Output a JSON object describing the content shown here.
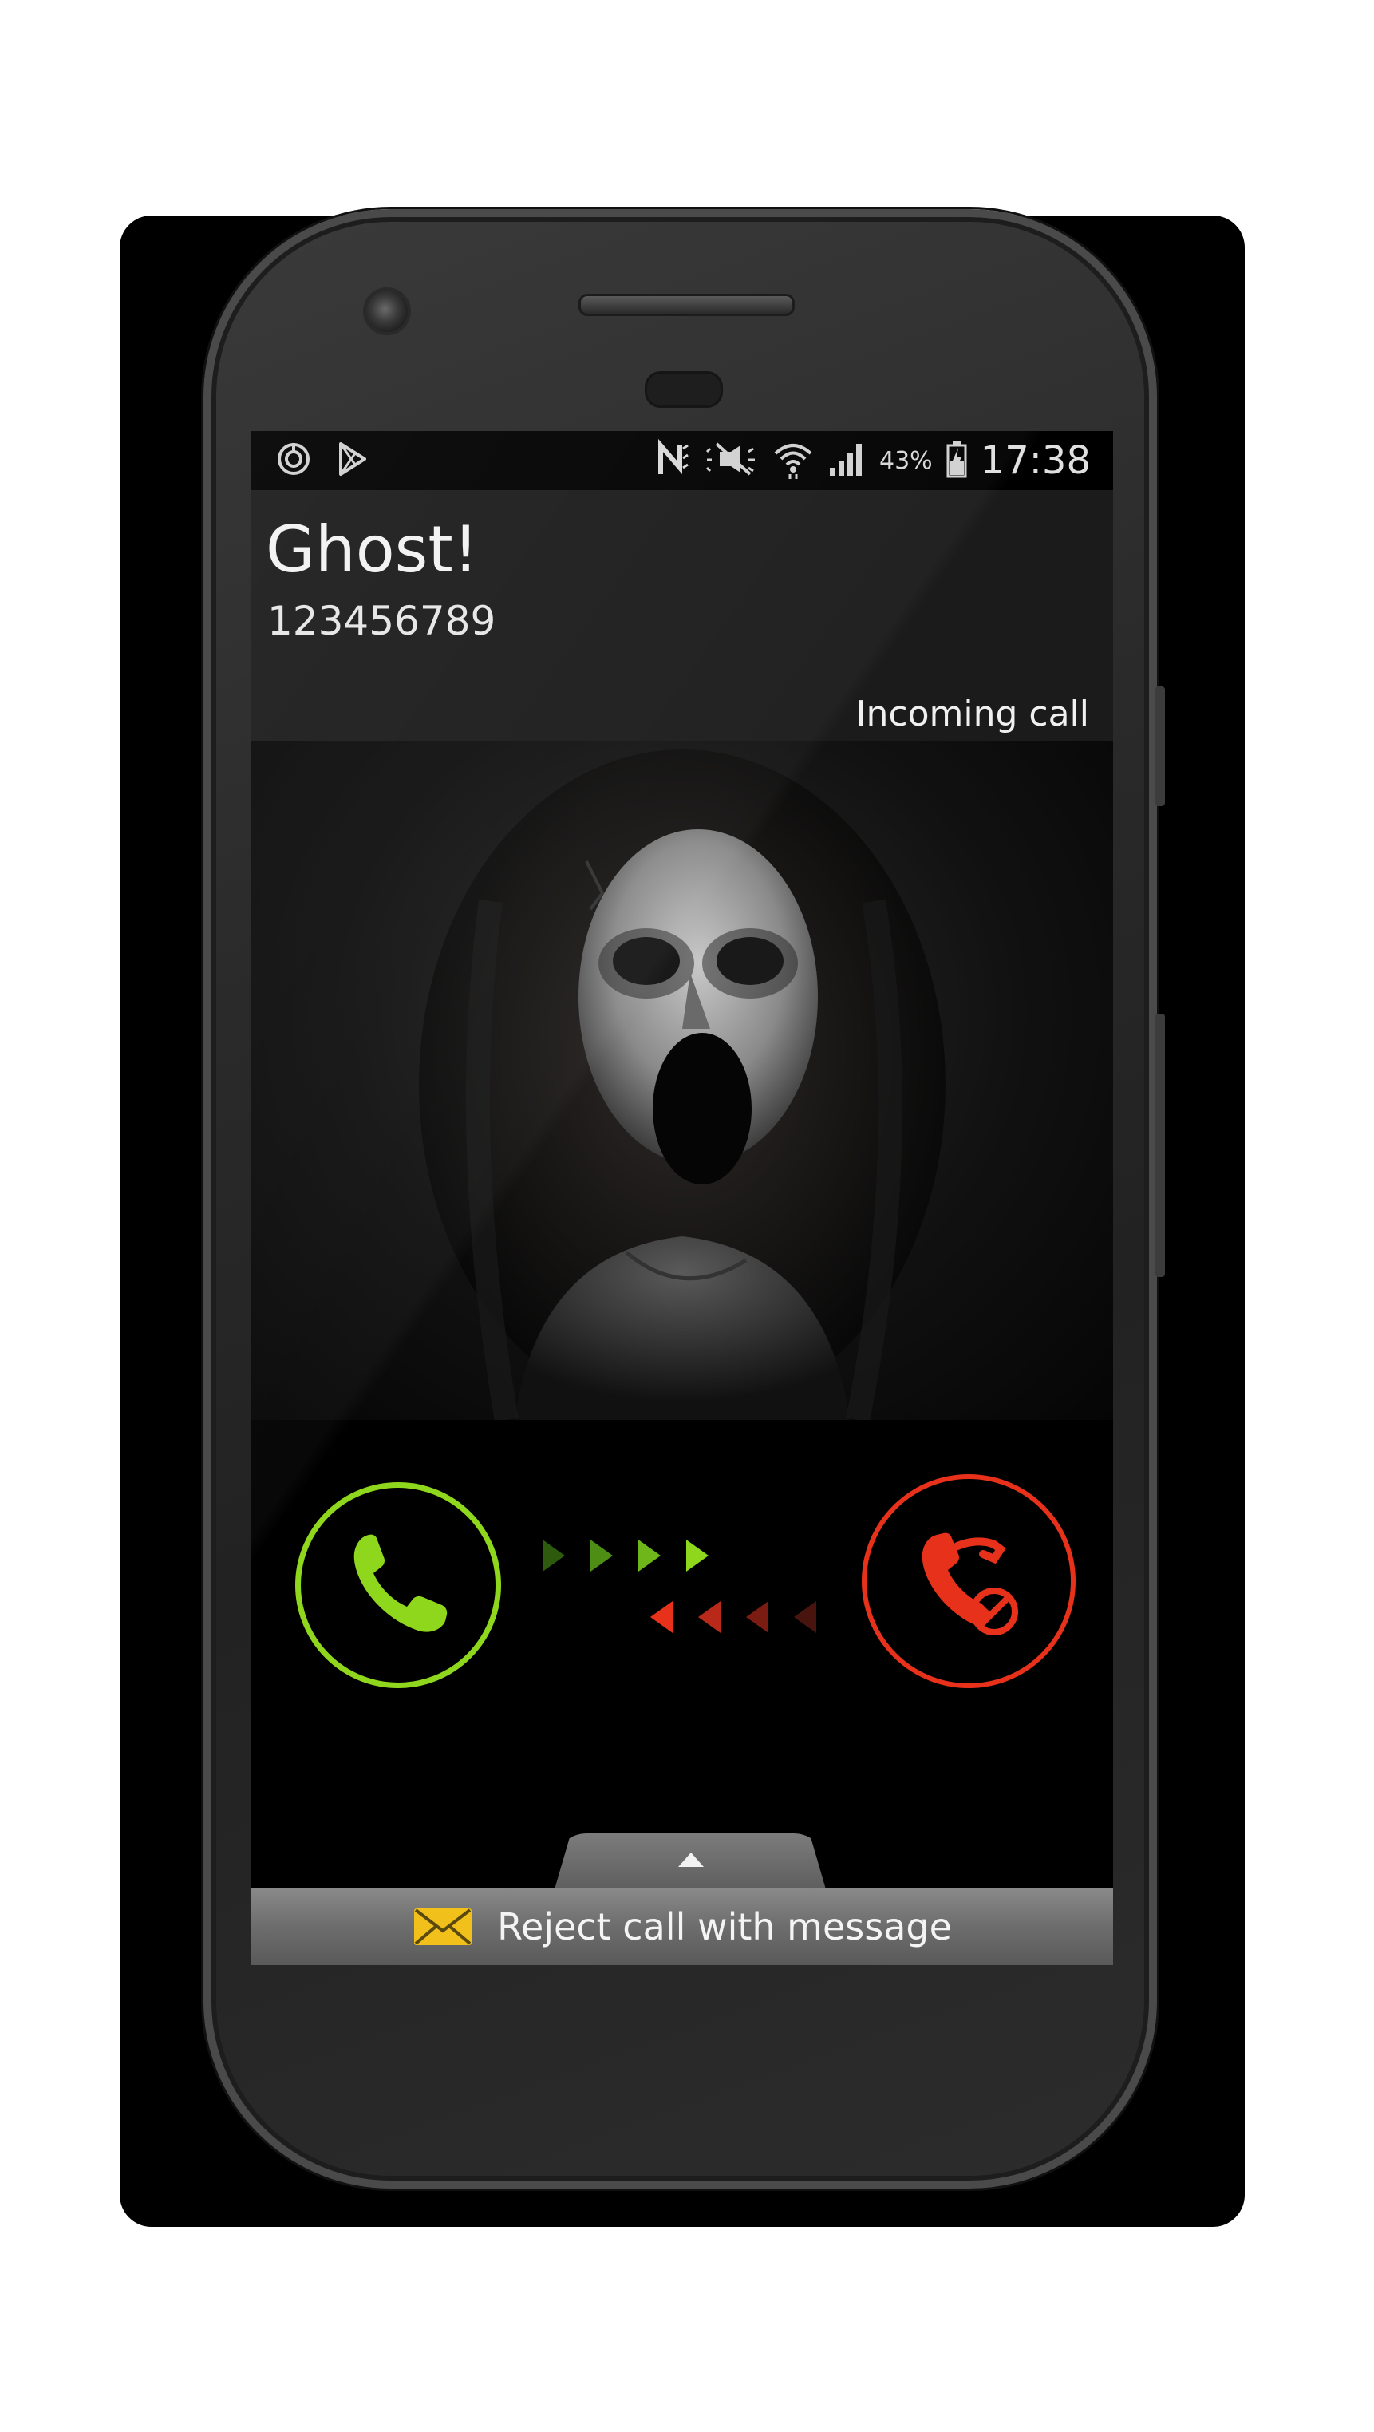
{
  "status_bar": {
    "left_icons": [
      "power-ring-icon",
      "play-store-icon"
    ],
    "right_icons": [
      "nfc-icon",
      "mute-icon",
      "wifi-icon",
      "signal-icon"
    ],
    "battery_percent": "43%",
    "time": "17:38"
  },
  "call": {
    "caller_name": "Ghost!",
    "caller_number": "123456789",
    "status": "Incoming call"
  },
  "controls": {
    "answer_icon": "phone-answer-icon",
    "reject_icon": "phone-reject-icon",
    "answer_color": "#8fd71d",
    "reject_color": "#e8311a"
  },
  "reject_message": {
    "icon": "envelope-icon",
    "label": "Reject call with message"
  }
}
